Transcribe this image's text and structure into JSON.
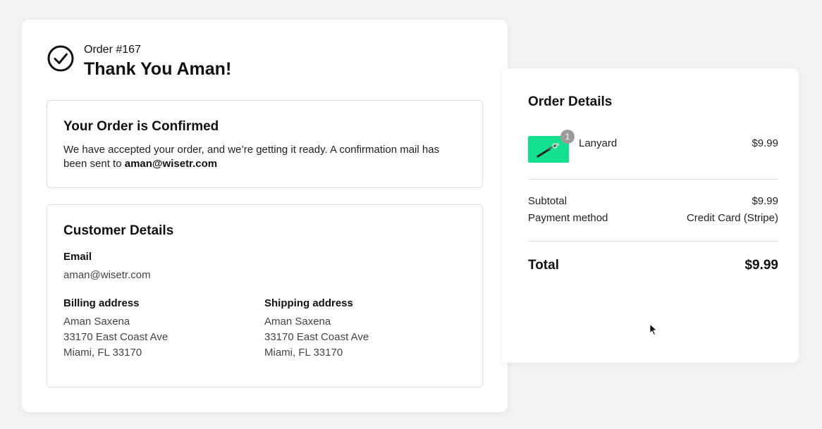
{
  "header": {
    "order_number": "Order #167",
    "thank_you": "Thank You Aman!"
  },
  "confirmation": {
    "title": "Your Order is Confirmed",
    "message": "We have accepted your order, and we’re getting it ready. A confirmation mail has been sent to ",
    "email": "aman@wisetr.com"
  },
  "customer": {
    "title": "Customer Details",
    "email_label": "Email",
    "email_value": "aman@wisetr.com",
    "billing_label": "Billing address",
    "billing": [
      "Aman Saxena",
      "33170 East Coast Ave",
      "Miami, FL 33170"
    ],
    "shipping_label": "Shipping address",
    "shipping": [
      "Aman Saxena",
      "33170 East Coast Ave",
      "Miami, FL 33170"
    ]
  },
  "order_details": {
    "title": "Order Details",
    "items": [
      {
        "name": "Lanyard",
        "price": "$9.99",
        "quantity": "1",
        "thumb_color": "#13e08f"
      }
    ],
    "subtotal_label": "Subtotal",
    "subtotal_value": "$9.99",
    "payment_label": "Payment method",
    "payment_value": "Credit Card (Stripe)",
    "total_label": "Total",
    "total_value": "$9.99"
  }
}
